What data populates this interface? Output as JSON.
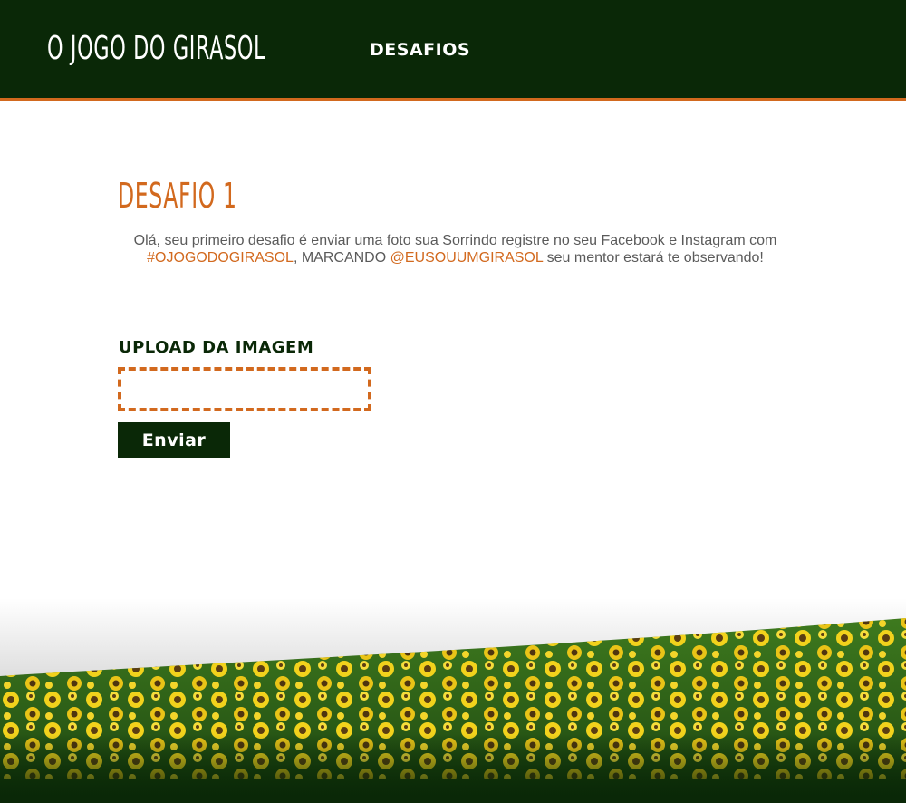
{
  "header": {
    "logo": "O JOGO DO GIRASOL",
    "nav": [
      "DESAFIOS"
    ]
  },
  "challenge": {
    "title": "DESAFIO 1",
    "text_1": "Olá, seu primeiro desafio é enviar uma foto sua Sorrindo registre no seu Facebook e Instagram com ",
    "hashtag": "#OJOGODOGIRASOL",
    "text_2": ", MARCANDO ",
    "mention": "@EUSOUUMGIRASOL",
    "text_3": " seu mentor estará te observando!"
  },
  "upload": {
    "label": "UPLOAD DA IMAGEM",
    "submit": "Enviar"
  },
  "colors": {
    "dark_green": "#0a2807",
    "accent_orange": "#d2691e",
    "text_gray": "#5a5a5a"
  },
  "decor": {
    "footer_image": "sunflower-field"
  }
}
